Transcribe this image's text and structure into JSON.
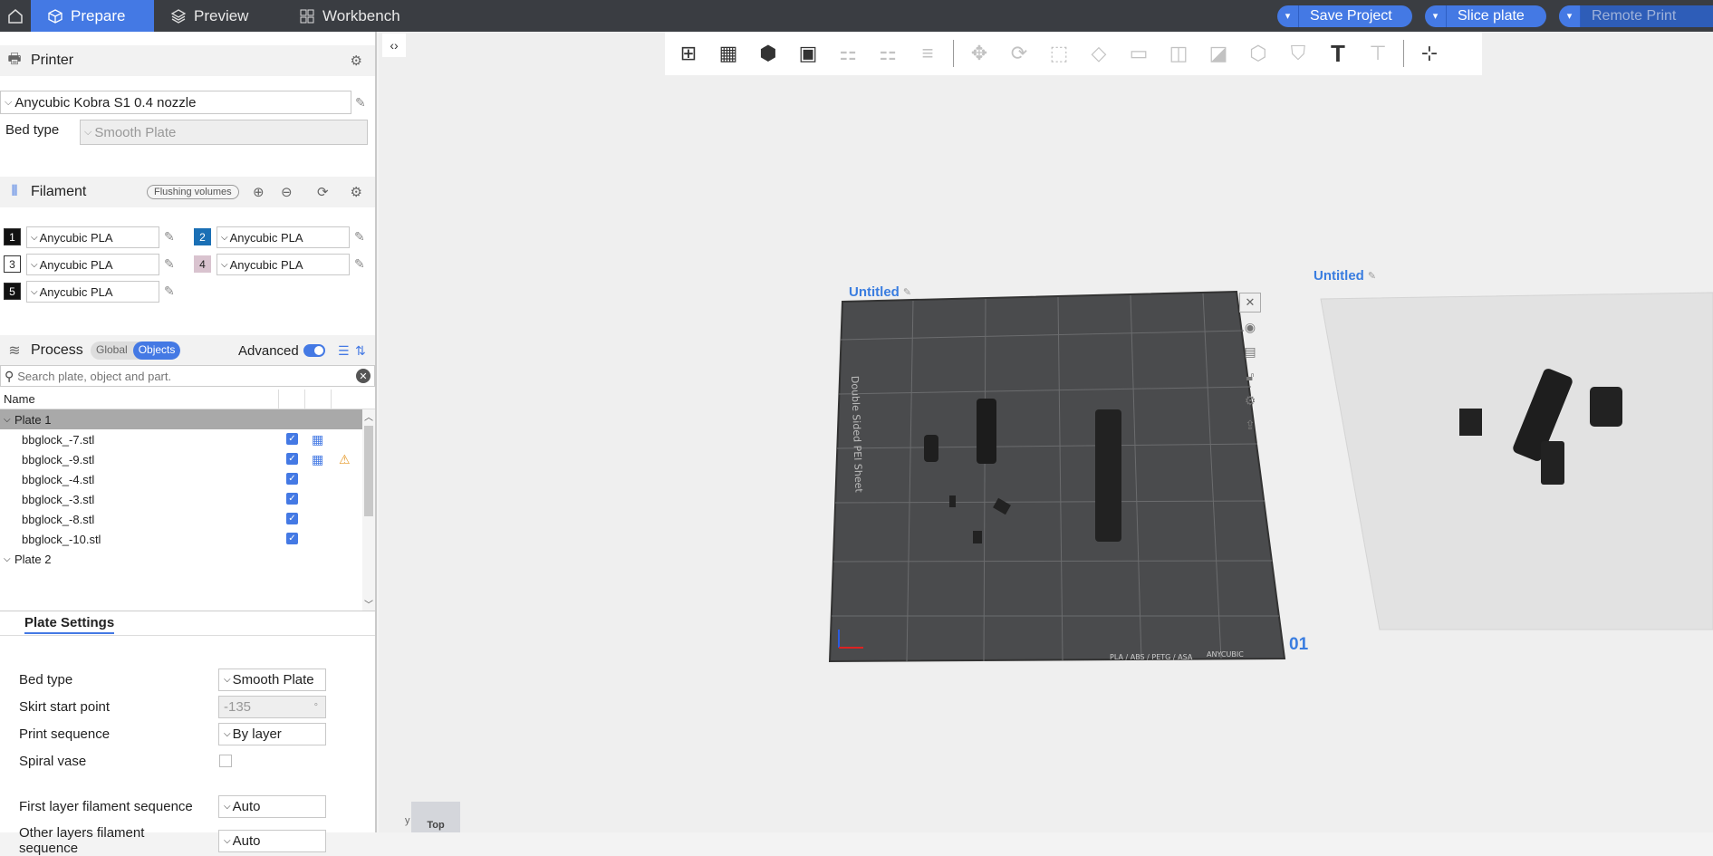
{
  "topbar": {
    "tabs": [
      {
        "label": "Prepare",
        "icon": "cube-icon"
      },
      {
        "label": "Preview",
        "icon": "layers-icon"
      },
      {
        "label": "Workbench",
        "icon": "grid-icon"
      }
    ],
    "save_label": "Save Project",
    "slice_label": "Slice plate",
    "remote_label": "Remote Print"
  },
  "printer": {
    "section_title": "Printer",
    "preset": "Anycubic Kobra S1 0.4 nozzle",
    "bed_type_label": "Bed type",
    "bed_type_value": "Smooth Plate"
  },
  "filament": {
    "section_title": "Filament",
    "flushing_label": "Flushing volumes",
    "slots": [
      {
        "num": "1",
        "name": "Anycubic PLA",
        "color": "#111111",
        "text_color": "#ffffff"
      },
      {
        "num": "2",
        "name": "Anycubic PLA",
        "color": "#1a6fb5",
        "text_color": "#ffffff"
      },
      {
        "num": "3",
        "name": "Anycubic PLA",
        "color": "#ffffff",
        "text_color": "#222222"
      },
      {
        "num": "4",
        "name": "Anycubic PLA",
        "color": "#d9c3cf",
        "text_color": "#222222"
      },
      {
        "num": "5",
        "name": "Anycubic PLA",
        "color": "#111111",
        "text_color": "#ffffff"
      }
    ]
  },
  "process": {
    "section_title": "Process",
    "global_label": "Global",
    "objects_label": "Objects",
    "advanced_label": "Advanced",
    "search_placeholder": "Search plate, object and part.",
    "name_header": "Name",
    "plates": [
      {
        "label": "Plate 1",
        "items": [
          "bbglock_-7.stl",
          "bbglock_-9.stl",
          "bbglock_-4.stl",
          "bbglock_-3.stl",
          "bbglock_-8.stl",
          "bbglock_-10.stl"
        ]
      },
      {
        "label": "Plate 2",
        "items": []
      }
    ]
  },
  "plate_settings": {
    "tab_label": "Plate Settings",
    "rows": [
      {
        "label": "Bed type",
        "value": "Smooth Plate"
      },
      {
        "label": "Skirt start point",
        "value": "-135",
        "unit": "°"
      },
      {
        "label": "Print sequence",
        "value": "By layer"
      },
      {
        "label": "Spiral vase",
        "value": ""
      },
      {
        "label": "First layer filament sequence",
        "value": "Auto"
      },
      {
        "label": "Other layers filament sequence",
        "value": "Auto"
      }
    ]
  },
  "viewport": {
    "plate1_name": "Untitled",
    "plate2_name": "Untitled",
    "plate_number": "01",
    "bed_text": "Double Sided PEI Sheet",
    "bed_footer": "PLA / ABS / PETG / ASA",
    "bed_brand": "ANYCUBIC",
    "view_label": "Top",
    "axis_label": "y"
  }
}
